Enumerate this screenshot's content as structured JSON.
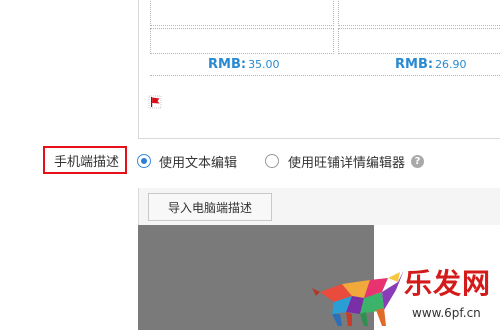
{
  "products": [
    {
      "currency": "RMB:",
      "amount": "35.00"
    },
    {
      "currency": "RMB:",
      "amount": "26.90"
    }
  ],
  "mobile_description": {
    "label": "手机端描述",
    "options": [
      {
        "label": "使用文本编辑",
        "checked": true
      },
      {
        "label": "使用旺铺详情编辑器",
        "checked": false
      }
    ],
    "help_icon": "question-icon",
    "import_button": "导入电脑端描述"
  },
  "watermark": {
    "brand": "乐发网",
    "url": "www.6pf.cn"
  },
  "colors": {
    "price": "#2a8ad1",
    "highlight_border": "#e5101b",
    "radio_checked": "#2a7fd4",
    "canvas_dark": "#7a7a7a"
  }
}
